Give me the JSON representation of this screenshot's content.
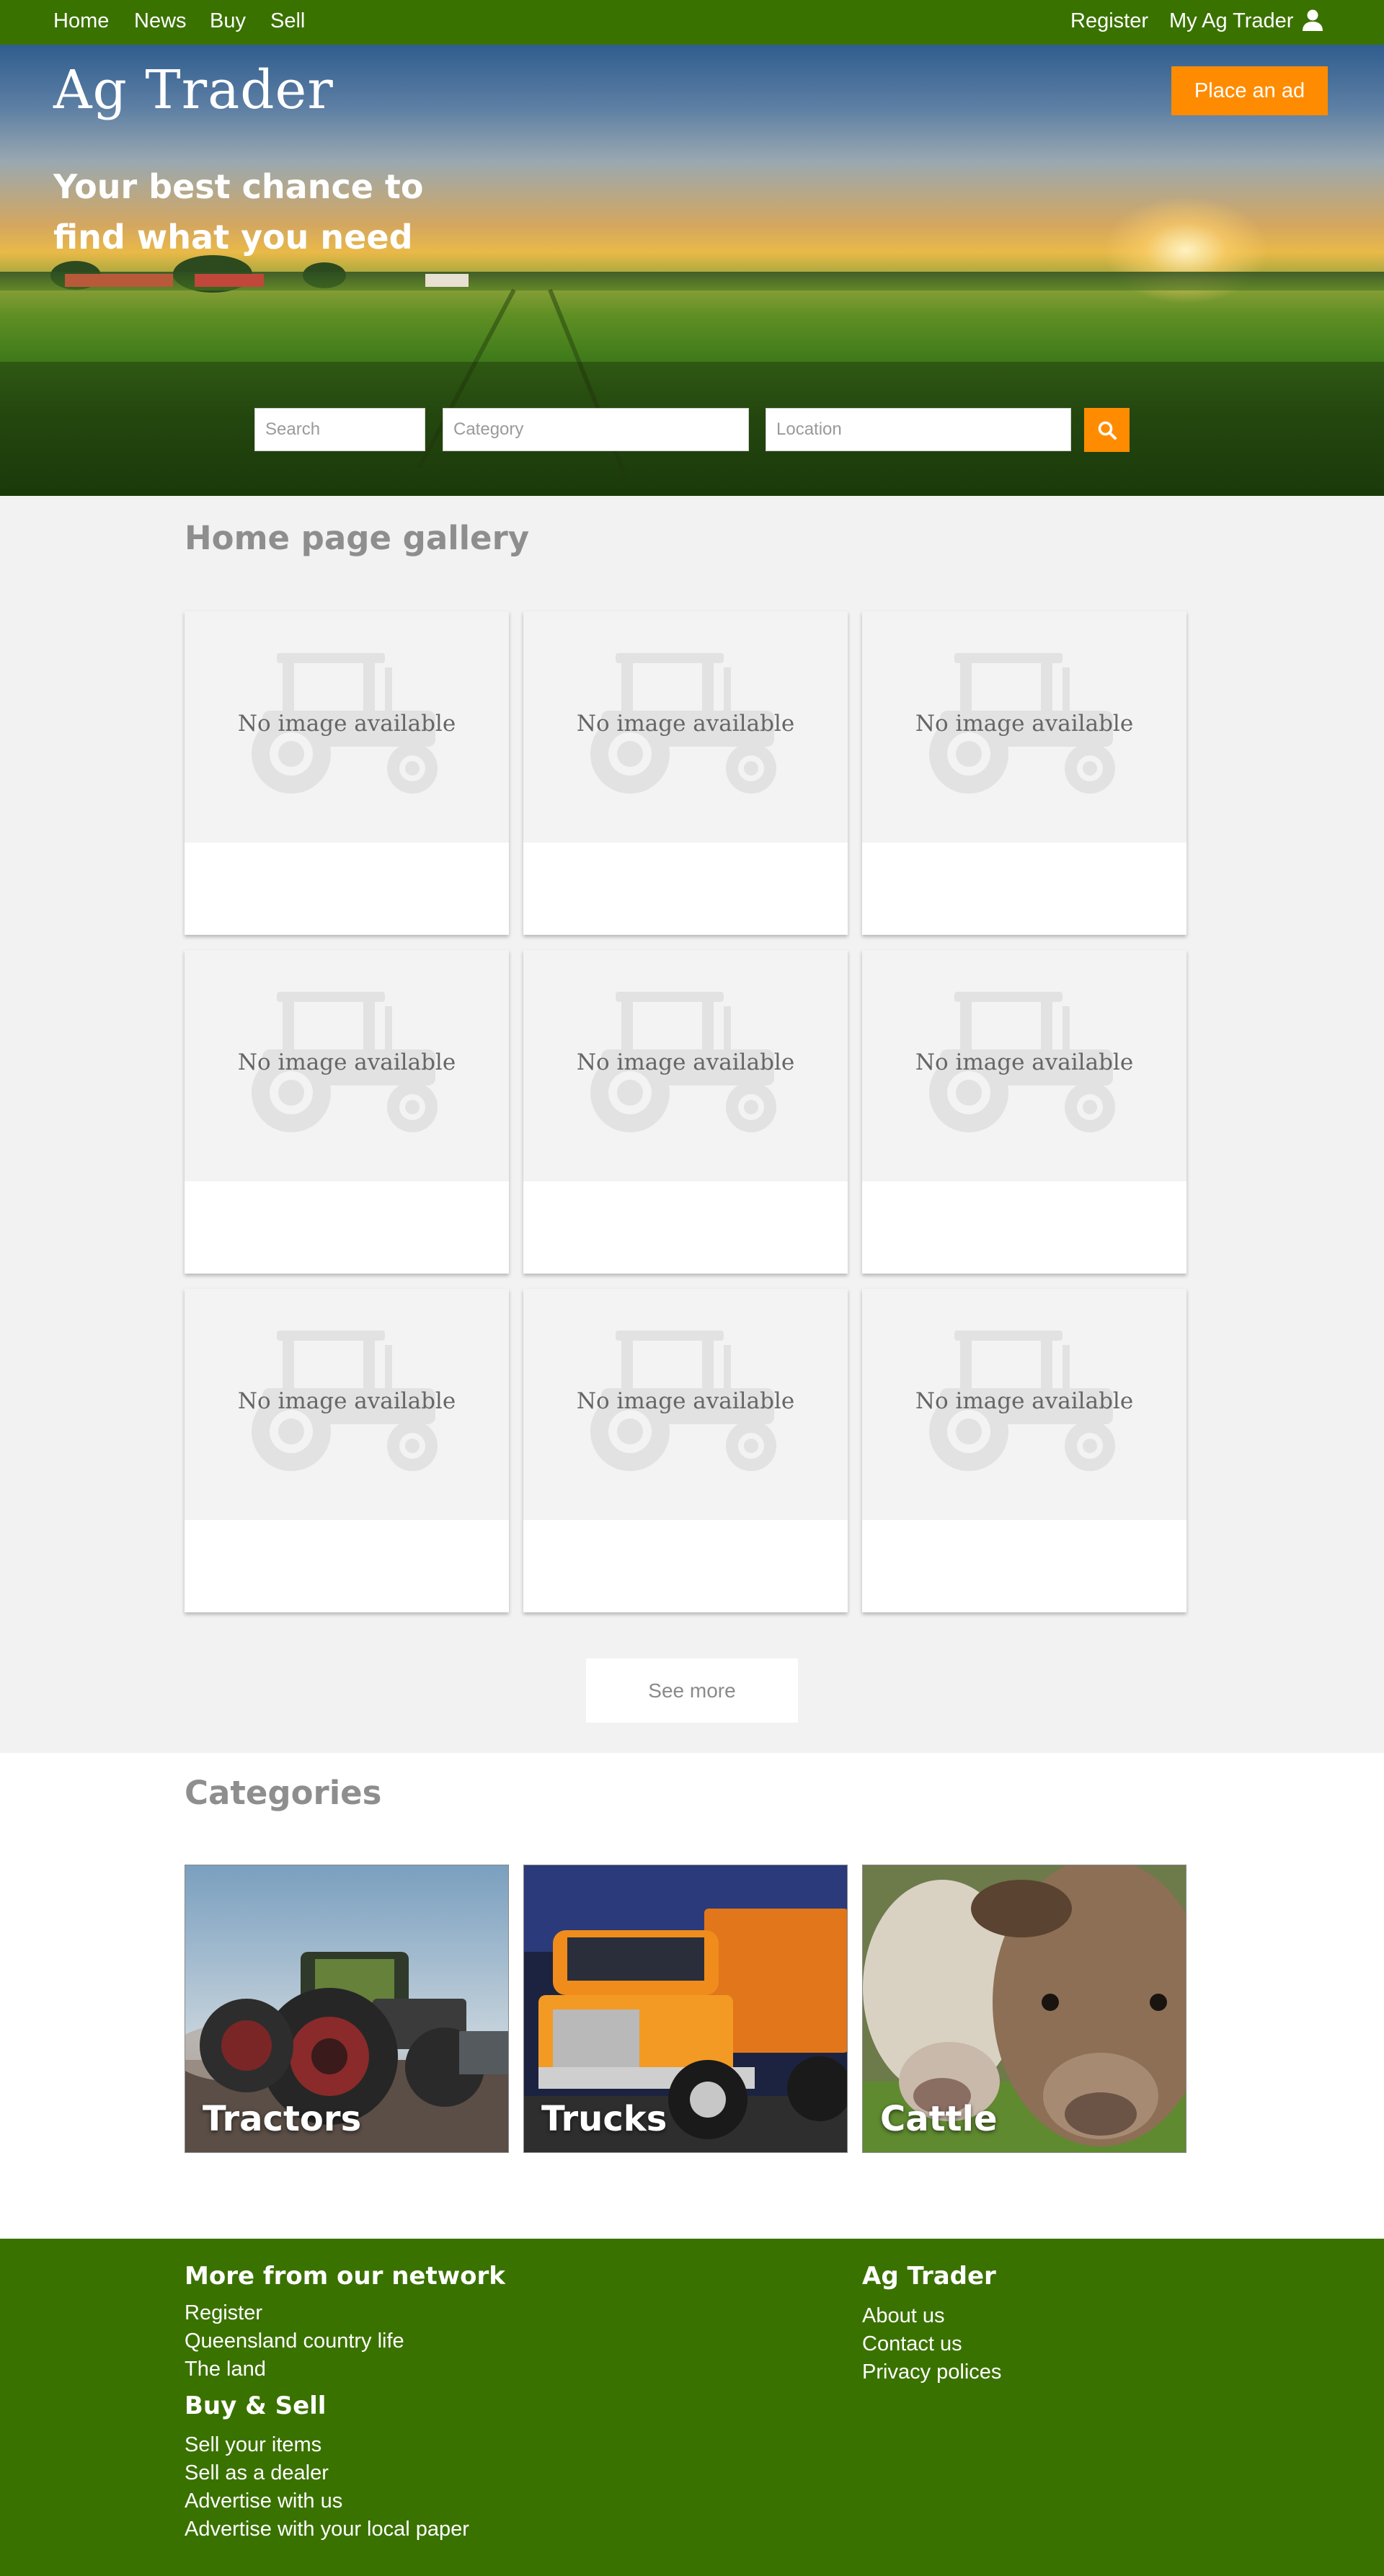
{
  "nav": {
    "home": "Home",
    "news": "News",
    "buy": "Buy",
    "sell": "Sell",
    "register": "Register",
    "my_account": "My Ag Trader",
    "user_icon": "user-icon"
  },
  "hero": {
    "logo": "Ag Trader",
    "tagline": "Your best chance to find what you need",
    "place_ad": "Place an ad"
  },
  "search": {
    "search_placeholder": "Search",
    "category_placeholder": "Category",
    "location_placeholder": "Location",
    "button_icon": "search-icon"
  },
  "gallery": {
    "title": "Home page gallery",
    "placeholder_icon": "tractor-icon",
    "items": [
      {
        "no_image": "No image available"
      },
      {
        "no_image": "No image available"
      },
      {
        "no_image": "No image available"
      },
      {
        "no_image": "No image available"
      },
      {
        "no_image": "No image available"
      },
      {
        "no_image": "No image available"
      },
      {
        "no_image": "No image available"
      },
      {
        "no_image": "No image available"
      },
      {
        "no_image": "No image available"
      }
    ],
    "see_more": "See more"
  },
  "categories": {
    "title": "Categories",
    "items": [
      {
        "label": "Tractors"
      },
      {
        "label": "Trucks"
      },
      {
        "label": "Cattle"
      }
    ]
  },
  "footer": {
    "network": {
      "heading": "More from our network",
      "links": [
        "Register",
        "Queensland country life",
        "The land"
      ]
    },
    "buysell": {
      "heading": "Buy & Sell",
      "links": [
        "Sell your items",
        "Sell as a dealer",
        "Advertise with us",
        "Advertise with your local paper"
      ]
    },
    "agtrader": {
      "heading": "Ag Trader",
      "links": [
        "About us",
        "Contact us",
        "Privacy polices"
      ]
    }
  },
  "colors": {
    "brand_green": "#3a7200",
    "accent_orange": "#ff8c00",
    "title_grey": "#8e8e8e",
    "gallery_bg": "#f2f2f2"
  }
}
